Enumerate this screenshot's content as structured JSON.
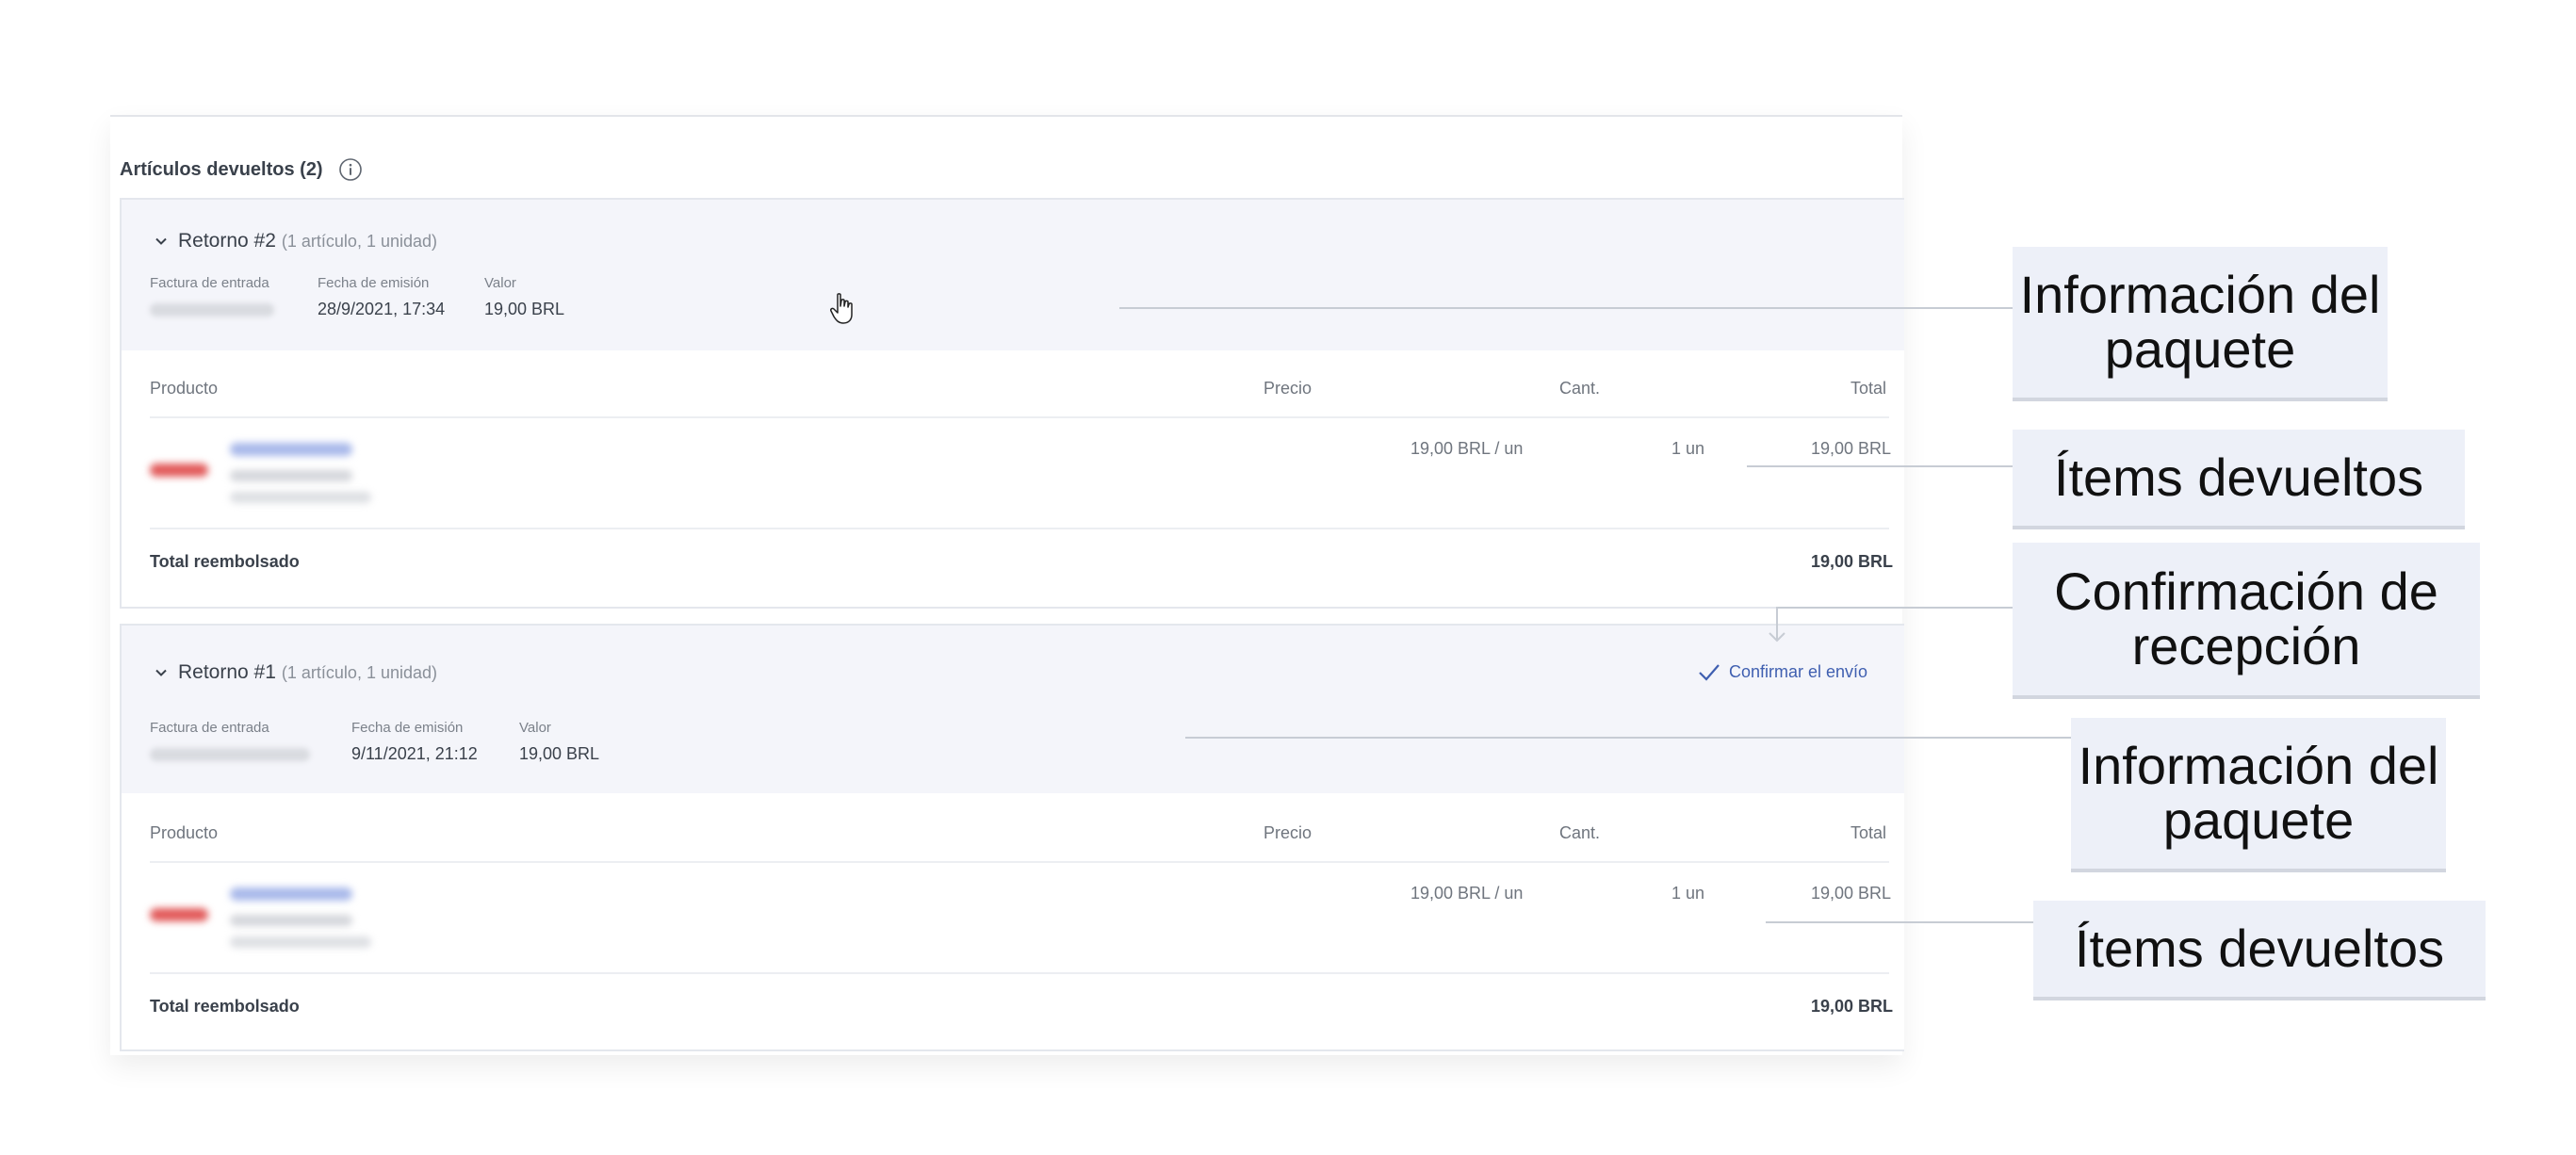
{
  "section": {
    "title": "Artículos devueltos (2)",
    "info_icon": "info-icon"
  },
  "returns": [
    {
      "title": "Retorno #2",
      "subtitle": "(1 artículo, 1 unidad)",
      "invoice_label": "Factura de entrada",
      "date_label": "Fecha de emisión",
      "date_value": "28/9/2021, 17:34",
      "value_label": "Valor",
      "value_value": "19,00 BRL",
      "columns": {
        "product": "Producto",
        "price": "Precio",
        "qty": "Cant.",
        "total": "Total"
      },
      "item": {
        "price": "19,00 BRL / un",
        "qty": "1 un",
        "total": "19,00 BRL"
      },
      "refund_label": "Total reembolsado",
      "refund_value": "19,00 BRL"
    },
    {
      "title": "Retorno #1",
      "subtitle": "(1 artículo, 1 unidad)",
      "invoice_label": "Factura de entrada",
      "date_label": "Fecha de emisión",
      "date_value": "9/11/2021, 21:12",
      "value_label": "Valor",
      "value_value": "19,00 BRL",
      "columns": {
        "product": "Producto",
        "price": "Precio",
        "qty": "Cant.",
        "total": "Total"
      },
      "item": {
        "price": "19,00 BRL / un",
        "qty": "1 un",
        "total": "19,00 BRL"
      },
      "refund_label": "Total reembolsado",
      "refund_value": "19,00 BRL",
      "confirm_label": "Confirmar el envío"
    }
  ],
  "callouts": {
    "package_info_1": "Información del paquete",
    "returned_items_1": "Ítems devueltos",
    "receipt_confirmation": "Confirmación de recepción",
    "package_info_2": "Información del paquete",
    "returned_items_2": "Ítems devueltos"
  },
  "colors": {
    "header_bg": "#f4f5fa",
    "accent_link": "#3f5fb0",
    "callout_bg": "#edf0f8"
  }
}
